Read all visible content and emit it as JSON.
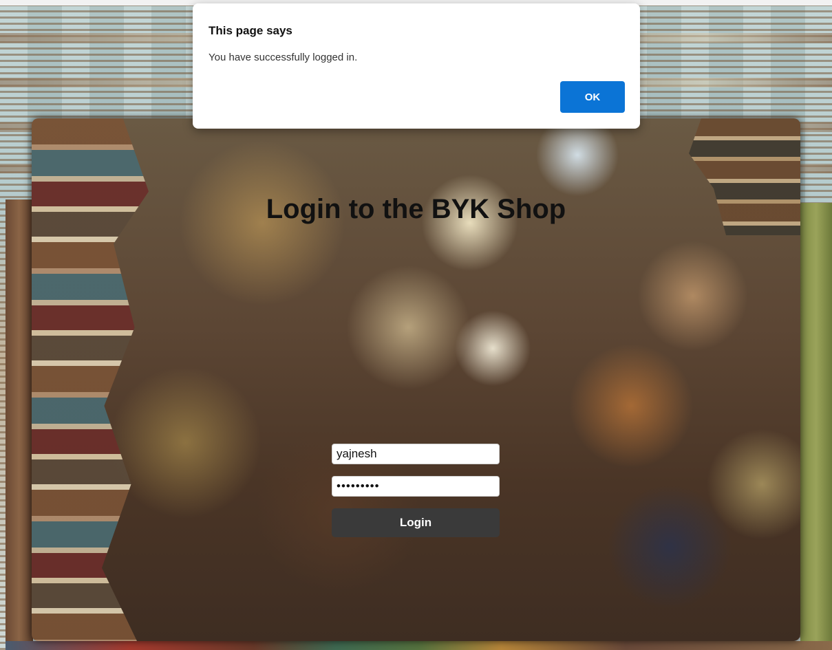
{
  "page": {
    "title": "Login to the BYK Shop"
  },
  "form": {
    "username_value": "yajnesh",
    "password_value": "•••••••••",
    "login_label": "Login"
  },
  "dialog": {
    "title": "This page says",
    "message": "You have successfully logged in.",
    "ok_label": "OK"
  },
  "colors": {
    "dialog_ok_bg": "#0b74d6",
    "login_button_bg": "#3a3a3a",
    "title_text": "#111111"
  }
}
